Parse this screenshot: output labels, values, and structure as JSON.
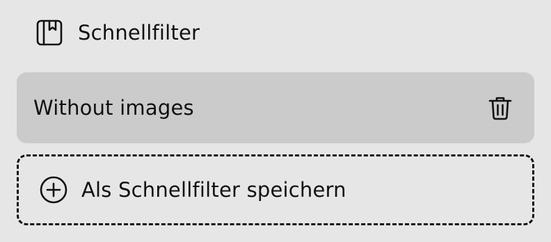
{
  "section": {
    "icon": "bookmark-book-icon",
    "title": "Schnellfilter"
  },
  "filters": [
    {
      "label": "Without images",
      "delete_icon": "trash-icon"
    }
  ],
  "save_button": {
    "icon": "plus-circle-icon",
    "label": "Als Schnellfilter speichern"
  },
  "colors": {
    "background": "#e6e6e6",
    "item_background": "#cbcbcb",
    "text": "#111111"
  }
}
